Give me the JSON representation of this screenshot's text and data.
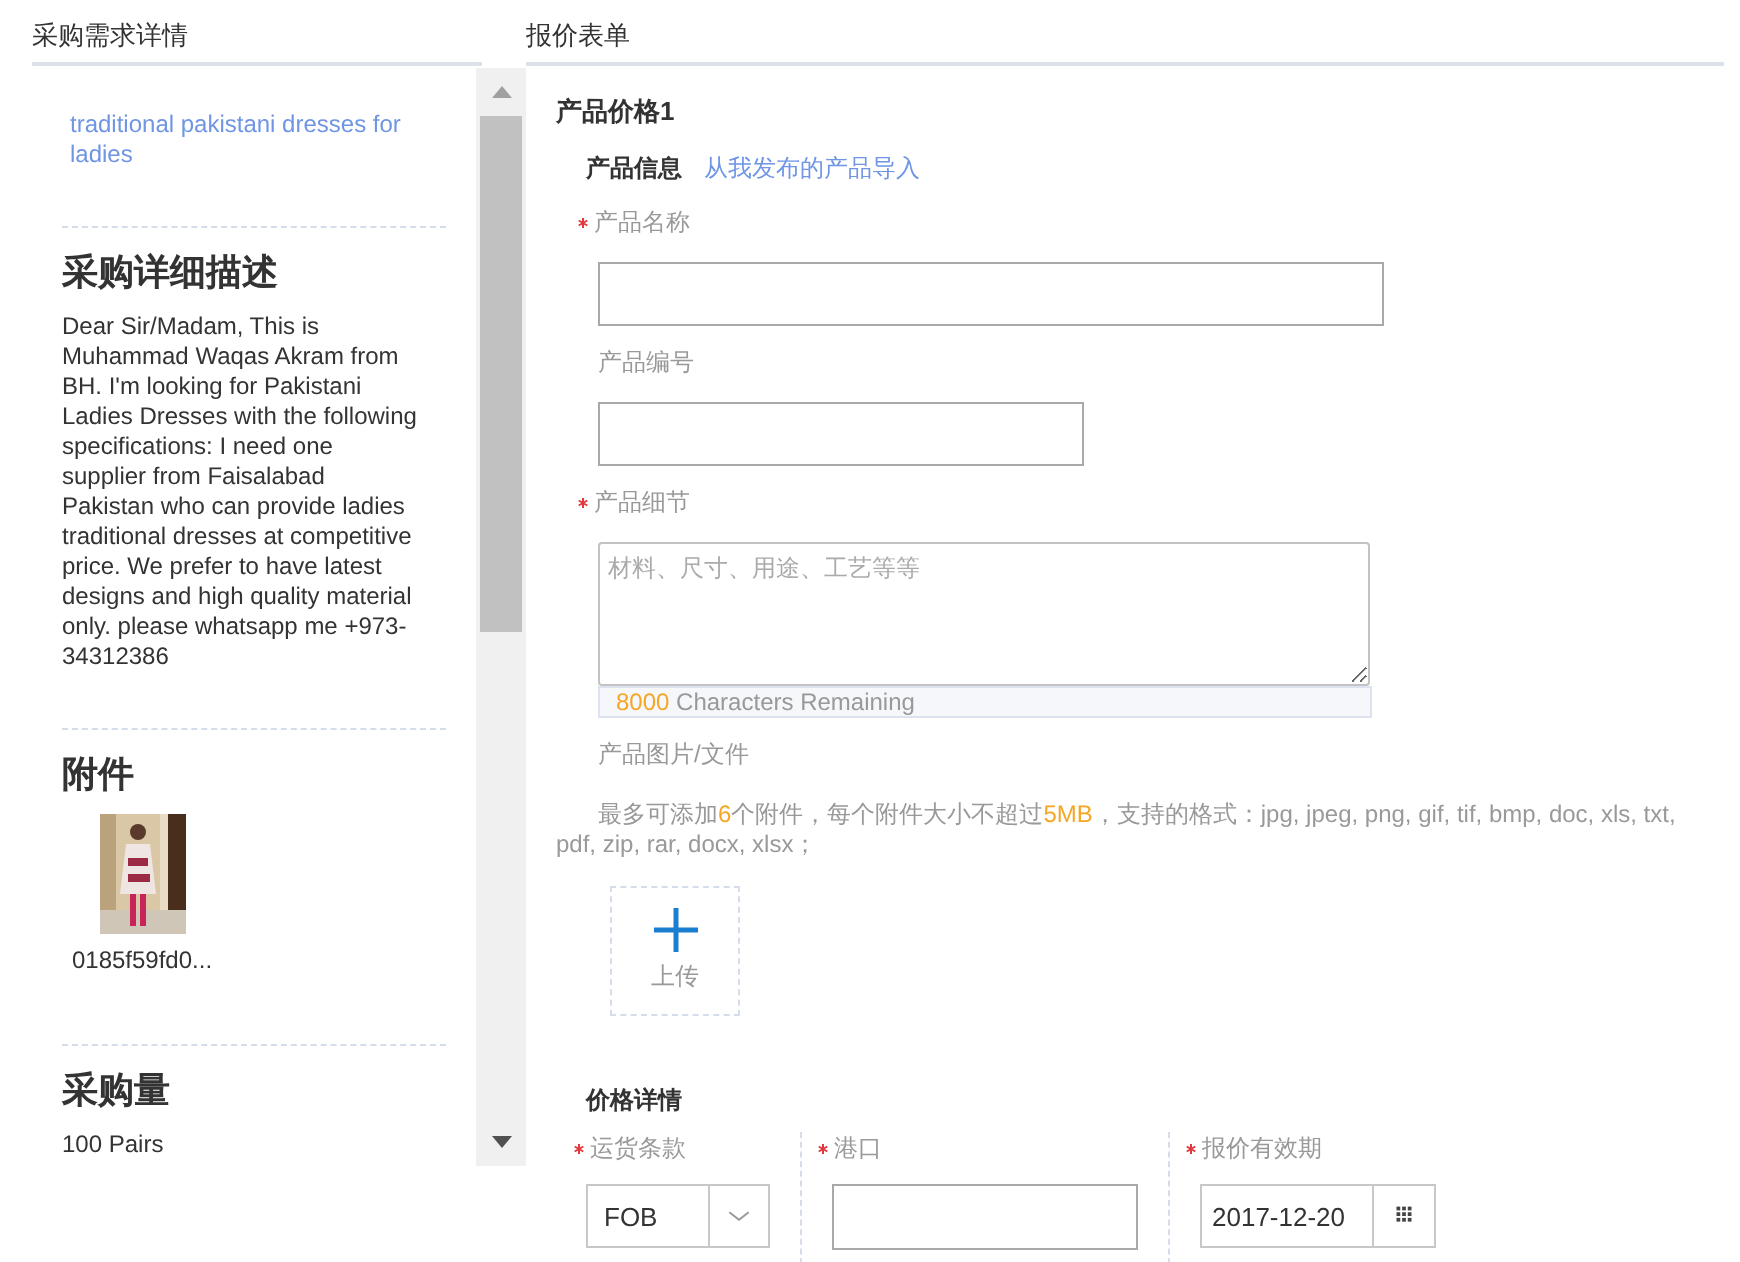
{
  "left_panel": {
    "title": "采购需求详情",
    "product_link": "traditional pakistani dresses for ladies",
    "description": {
      "heading": "采购详细描述",
      "text": "Dear Sir/Madam, This is Muhammad Waqas Akram from BH. I'm looking for Pakistani Ladies Dresses with the following specifications: I need one supplier from Faisalabad Pakistan who can provide ladies traditional dresses at competitive price. We prefer to have latest designs and high quality material only. please whatsapp me +973-34312386"
    },
    "attachments": {
      "heading": "附件",
      "files": [
        {
          "kind": "picture",
          "name": "0185f59fd0..."
        }
      ]
    },
    "quantity": {
      "heading": "采购量",
      "value": "100 Pairs"
    }
  },
  "right_panel": {
    "title": "报价表单",
    "section_title": "产品价格1",
    "product_info": {
      "title": "产品信息",
      "import_link": "从我发布的产品导入"
    },
    "fields": [
      {
        "label": "产品名称",
        "required": true,
        "kind": "input"
      },
      {
        "label": "产品编号",
        "required": false,
        "kind": "shortinput"
      },
      {
        "label": "产品细节",
        "required": true,
        "kind": "textarea",
        "placeholder": "材料、尺寸、用途、工艺等等",
        "counter": {
          "count": "8000",
          "label": "Characters Remaining"
        }
      }
    ],
    "files": {
      "label": "产品图片/文件",
      "hint": [
        {
          "text": "最多可添加",
          "highlight": false
        },
        {
          "text": "6",
          "highlight": true
        },
        {
          "text": "个附件，每个附件大小不超过",
          "highlight": false
        },
        {
          "text": "5MB",
          "highlight": true
        },
        {
          "text": "，支持的格式：jpg, jpeg, png, gif, tif, bmp, doc, xls, txt, pdf, zip, rar, docx, xlsx；",
          "highlight": false
        }
      ],
      "upload_button": "上传"
    },
    "price_details": {
      "title": "价格详情",
      "columns": [
        {
          "label": "运货条款",
          "required": true,
          "kind": "select",
          "value": "FOB"
        },
        {
          "label": "港口",
          "required": true,
          "kind": "input"
        },
        {
          "label": "报价有效期",
          "required": true,
          "kind": "date",
          "value": "2017-12-20"
        }
      ]
    }
  }
}
